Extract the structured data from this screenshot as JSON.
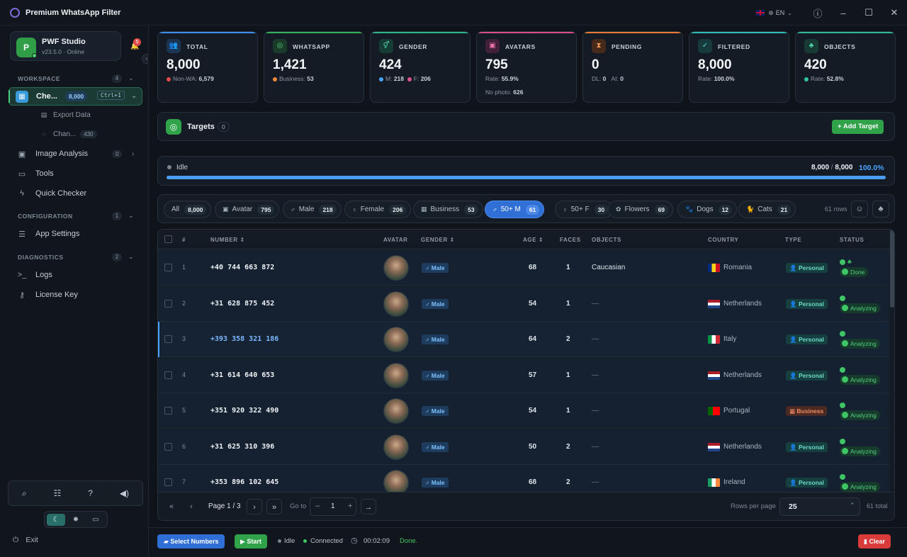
{
  "app": {
    "title": "Premium WhatsApp Filter",
    "lang": "EN"
  },
  "profile": {
    "initial": "P",
    "name": "PWF Studio",
    "version": "v23.5.0 · Online",
    "notifications": "5"
  },
  "sidebar": {
    "sections": [
      {
        "label": "WORKSPACE",
        "count": "4"
      },
      {
        "label": "CONFIGURATION",
        "count": "1"
      },
      {
        "label": "DIAGNOSTICS",
        "count": "2"
      }
    ],
    "active": {
      "label": "Che...",
      "count": "8,000",
      "shortcut": "Ctrl+1"
    },
    "sub_items": [
      {
        "label": "Export Data"
      },
      {
        "label": "Chan...",
        "count": "430"
      }
    ],
    "items": [
      {
        "label": "Image Analysis",
        "count": "0"
      },
      {
        "label": "Tools"
      },
      {
        "label": "Quick Checker"
      },
      {
        "label": "App Settings"
      },
      {
        "label": "Logs"
      },
      {
        "label": "License Key"
      }
    ],
    "exit_label": "Exit"
  },
  "stats": [
    {
      "label": "TOTAL",
      "value": "8,000",
      "sub1_label": "Non-WA:",
      "sub1_value": "6,579",
      "color": "#4aa3ff"
    },
    {
      "label": "WHATSAPP",
      "value": "1,421",
      "sub1_label": "Business:",
      "sub1_value": "53",
      "color": "#3ec565"
    },
    {
      "label": "GENDER",
      "value": "424",
      "sub1_label": "M:",
      "sub1_value": "218",
      "sub2_label": "F:",
      "sub2_value": "206",
      "color": "#30c090"
    },
    {
      "label": "AVATARS",
      "value": "795",
      "sub1_label": "Rate:",
      "sub1_value": "55.9%",
      "sub3_label": "No photo:",
      "sub3_value": "626",
      "color": "#e0508a"
    },
    {
      "label": "PENDING",
      "value": "0",
      "sub1_label": "DL:",
      "sub1_value": "0",
      "sub2_label": "AI:",
      "sub2_value": "0",
      "color": "#f08030"
    },
    {
      "label": "FILTERED",
      "value": "8,000",
      "sub1_label": "Rate:",
      "sub1_value": "100.0%",
      "color": "#30c8c0"
    },
    {
      "label": "OBJECTS",
      "value": "420",
      "sub1_label": "Rate:",
      "sub1_value": "52.8%",
      "color": "#30c0a0"
    }
  ],
  "targets": {
    "label": "Targets",
    "count": "0",
    "add_label": "Add Target"
  },
  "progress": {
    "status": "Idle",
    "done": "8,000",
    "total": "8,000",
    "percent_label": "100.0%",
    "fraction": 1.0
  },
  "filters": [
    {
      "label": "All",
      "count": "8,000",
      "icon": ""
    },
    {
      "label": "Avatar",
      "count": "795",
      "icon": "image-icon"
    },
    {
      "label": "Male",
      "count": "218",
      "icon": "male-icon"
    },
    {
      "label": "Female",
      "count": "206",
      "icon": "female-icon"
    },
    {
      "label": "Business",
      "count": "53",
      "icon": "briefcase-icon"
    },
    {
      "label": "50+ M",
      "count": "61",
      "icon": "male-icon"
    },
    {
      "label": "50+ F",
      "count": "30",
      "icon": "female-icon"
    },
    {
      "label": "Flowers",
      "count": "69",
      "icon": "flower-icon"
    },
    {
      "label": "Dogs",
      "count": "12",
      "icon": "dog-icon"
    },
    {
      "label": "Cats",
      "count": "21",
      "icon": "cat-icon"
    }
  ],
  "rows_label": "61 rows",
  "table": {
    "columns": [
      "#",
      "NUMBER",
      "AVATAR",
      "GENDER",
      "AGE",
      "FACES",
      "OBJECTS",
      "COUNTRY",
      "TYPE",
      "STATUS"
    ],
    "rows": [
      {
        "idx": "1",
        "number": "+40 744 663 872",
        "gender": "Male",
        "age": "68",
        "faces": "1",
        "objects": "Caucasian",
        "country": "Romania",
        "type": "Personal",
        "status": "Done"
      },
      {
        "idx": "2",
        "number": "+31 628 875 452",
        "gender": "Male",
        "age": "54",
        "faces": "1",
        "objects": "—",
        "country": "Netherlands",
        "type": "Personal",
        "status": "Analyzing"
      },
      {
        "idx": "3",
        "number": "+393 358 321 186",
        "gender": "Male",
        "age": "64",
        "faces": "2",
        "objects": "—",
        "country": "Italy",
        "type": "Personal",
        "status": "Analyzing"
      },
      {
        "idx": "4",
        "number": "+31 614 640 653",
        "gender": "Male",
        "age": "57",
        "faces": "1",
        "objects": "—",
        "country": "Netherlands",
        "type": "Personal",
        "status": "Analyzing"
      },
      {
        "idx": "5",
        "number": "+351 920 322 490",
        "gender": "Male",
        "age": "54",
        "faces": "1",
        "objects": "—",
        "country": "Portugal",
        "type": "Business",
        "status": "Analyzing"
      },
      {
        "idx": "6",
        "number": "+31 625 310 396",
        "gender": "Male",
        "age": "50",
        "faces": "2",
        "objects": "—",
        "country": "Netherlands",
        "type": "Personal",
        "status": "Analyzing"
      },
      {
        "idx": "7",
        "number": "+353 896 102 645",
        "gender": "Male",
        "age": "68",
        "faces": "2",
        "objects": "—",
        "country": "Ireland",
        "type": "Personal",
        "status": "Analyzing"
      }
    ]
  },
  "pager": {
    "page_label": "Page 1 / 3",
    "goto_label": "Go to",
    "goto_value": "1",
    "rows_per_page_label": "Rows per page",
    "rows_per_page": "25",
    "total_label": "61 total"
  },
  "bottom": {
    "select_label": "Select Numbers",
    "start_label": "Start",
    "status": "Idle",
    "connection": "Connected",
    "timer": "00:02:09",
    "done_label": "Done.",
    "clear_label": "Clear"
  }
}
